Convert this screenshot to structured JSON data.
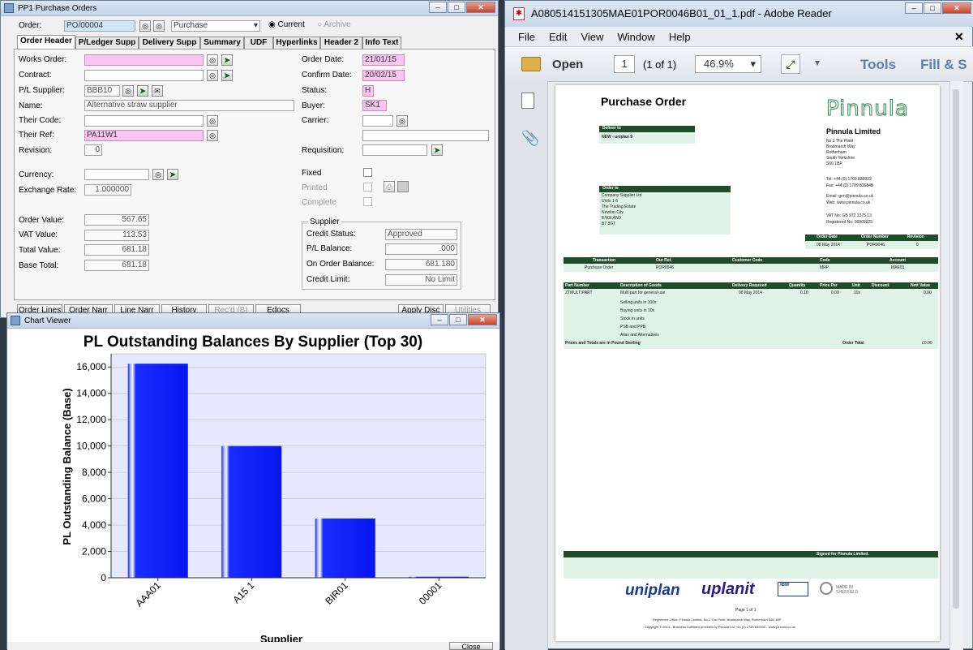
{
  "po_window": {
    "title": "PP1  Purchase Orders",
    "order_label": "Order:",
    "order_value": "PO/00004",
    "type_value": "Purchase",
    "radio_current": "Current",
    "radio_archive": "Archive",
    "tabs": [
      "Order Header",
      "P/Ledger Supp",
      "Delivery Supp",
      "Summary",
      "UDF",
      "Hyperlinks",
      "Header 2",
      "Info Text"
    ],
    "left_labels": {
      "works_order": "Works Order:",
      "contract": "Contract:",
      "pl_supplier": "P/L Supplier:",
      "name": "Name:",
      "their_code": "Their Code:",
      "their_ref": "Their Ref:",
      "revision": "Revision:",
      "currency": "Currency:",
      "exchange_rate": "Exchange Rate:",
      "order_value": "Order Value:",
      "vat_value": "VAT Value:",
      "total_value": "Total Value:",
      "base_total": "Base Total:"
    },
    "left_values": {
      "works_order": "",
      "contract": "",
      "pl_supplier": "BBB10",
      "name": "Alternative straw supplier",
      "their_code": "",
      "their_ref": "PA11W1",
      "revision": "0",
      "currency": "",
      "exchange_rate": "1.000000",
      "order_value": "567.65",
      "vat_value": "113.53",
      "total_value": "681.18",
      "base_total": "681.18"
    },
    "right_labels": {
      "order_date": "Order Date:",
      "confirm_date": "Confirm Date:",
      "status": "Status:",
      "buyer": "Buyer:",
      "carrier": "Carrier:",
      "requisition": "Requisition:",
      "fixed": "Fixed",
      "printed": "Printed",
      "complete": "Complete"
    },
    "right_values": {
      "order_date": "21/01/15",
      "confirm_date": "20/02/15",
      "status": "H",
      "buyer": "SK1",
      "carrier": "",
      "requisition": ""
    },
    "supplier_group": {
      "title": "Supplier",
      "credit_status_label": "Credit Status:",
      "credit_status": "Approved",
      "pl_balance_label": "P/L Balance:",
      "pl_balance": ".000",
      "on_order_label": "On Order Balance:",
      "on_order": "681.180",
      "credit_limit_label": "Credit Limit:",
      "credit_limit": "No Limit"
    },
    "bottom_buttons": [
      "Order Lines",
      "Order Narr",
      "Line Narr",
      "History",
      "Rec'd (B)",
      "Edocs",
      "Apply Disc",
      "Utilities"
    ]
  },
  "chart_window": {
    "title": "Chart Viewer",
    "close_label": "Close",
    "colors": {
      "bar": "#0a1bff",
      "plot_bg": "#e6e8fb"
    }
  },
  "chart_data": {
    "type": "bar",
    "title": "PL Outstanding Balances By Supplier (Top 30)",
    "xlabel": "Supplier",
    "ylabel": "PL Outstanding Balance (Base)",
    "categories": [
      "AAA01",
      "A15 1",
      "BIR01",
      "00001"
    ],
    "values": [
      16250,
      10000,
      4500,
      80
    ],
    "ylim": [
      0,
      17000
    ],
    "yticks": [
      0,
      2000,
      4000,
      6000,
      8000,
      10000,
      12000,
      14000,
      16000
    ],
    "ytick_labels": [
      "0",
      "2,000",
      "4,000",
      "6,000",
      "8,000",
      "10,000",
      "12,000",
      "14,000",
      "16,000"
    ],
    "grid": true
  },
  "reader": {
    "title": "A080514151305MAE01POR0046B01_01_1.pdf - Adobe Reader",
    "menu": [
      "File",
      "Edit",
      "View",
      "Window",
      "Help"
    ],
    "open_label": "Open",
    "page_num": "1",
    "page_of": "(1 of 1)",
    "zoom": "46.9%",
    "tools_label": "Tools",
    "fill_sign_label": "Fill & S"
  },
  "pdf": {
    "heading": "Purchase Order",
    "logo": "Pinnula",
    "company": "Pinnula Limited",
    "address": [
      "No.1 The Point",
      "Bradmarsh Way",
      "Rotherham",
      "South Yorkshire",
      "S60 1BP"
    ],
    "tel": "Tel: +44 (0) 1709 839933",
    "fax": "Fax: +44 (0) 1709 836848",
    "email": "Email: gen@pinnula.co.uk",
    "web": "Web: www.pinnula.co.uk",
    "vat": "VAT No: GB 972 1375 13",
    "reg": "Registered No: 06909925",
    "deliver_to_label": "Deliver to",
    "deliver_to": "NEW - uniplan 9",
    "order_to_label": "Order to",
    "order_to": [
      "Company Supplier Ltd",
      "Units 1-6",
      "The Trading Estate",
      "Newton City",
      "ENGLAND",
      "B7 8GT"
    ],
    "meta_headers": [
      "Order Date",
      "Order Number",
      "Revision"
    ],
    "meta_values": [
      "08 May 2014",
      "POR0046",
      "0"
    ],
    "trans_headers": [
      "Transaction",
      "Our Ref.",
      "Customer Code",
      "Code",
      "Account"
    ],
    "trans_values": [
      "Purchase Order",
      "POR0046",
      "",
      "MRP",
      "MAE01"
    ],
    "line_headers": [
      "Part Number",
      "Description of Goods",
      "Delivery Required",
      "Quantity",
      "Price Per",
      "Unit",
      "Discount",
      "Nett Value"
    ],
    "line_values": [
      "ZTMULTIPART",
      "Multi part for general use",
      "08 May 2014",
      "0.10",
      "0.00",
      "10s",
      "",
      "0.00"
    ],
    "line_desc_extra": [
      "Selling units in 100s",
      "Buying units in 10s",
      "Stock in units",
      "PSB and PPB",
      "Alias and Alternatives"
    ],
    "prices_note": "Prices and Totals are in Pound Sterling",
    "order_total_label": "Order Total",
    "order_total": "£0.00",
    "signed_for": "Signed for Pinnula Limited.",
    "logos": [
      "uniplan",
      "uplanit",
      "IBM",
      "MADE IN SHEFFIELD"
    ],
    "page_label": "Page 1 of 1",
    "footer1": "Registered Office: Pinnula Limited, No.1 The Point, Bradmarsh Way, Rotherham S60 1BP",
    "footer2": "Copyright © 2014 - Business Software provided by Pinnula Ltd +44 (0) 1709 839933 - www.pinnula.co.uk"
  }
}
